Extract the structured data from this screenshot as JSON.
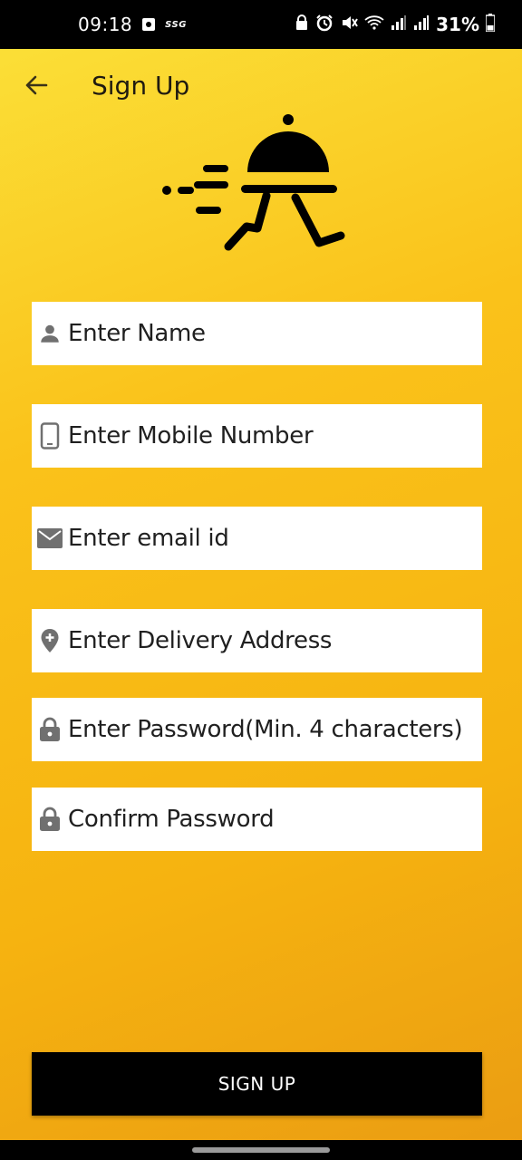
{
  "status_bar": {
    "time": "09:18",
    "carrier_badge": "SSG",
    "battery_percent": "31%",
    "icons": [
      "gallery-icon",
      "lock-icon",
      "alarm-icon",
      "mute-icon",
      "wifi-icon",
      "signal-icon",
      "signal-icon",
      "battery-icon"
    ]
  },
  "app_bar": {
    "title": "Sign Up",
    "back_icon": "arrow-left-icon"
  },
  "form": {
    "fields": [
      {
        "icon": "person-icon",
        "placeholder": "Enter Name"
      },
      {
        "icon": "phone-icon",
        "placeholder": "Enter Mobile Number"
      },
      {
        "icon": "mail-icon",
        "placeholder": "Enter email id"
      },
      {
        "icon": "location-pin-icon",
        "placeholder": "Enter Delivery Address"
      },
      {
        "icon": "lock-icon",
        "placeholder": "Enter Password(Min. 4 characters)"
      },
      {
        "icon": "lock-icon",
        "placeholder": "Confirm Password"
      }
    ],
    "submit_label": "SIGN UP"
  },
  "colors": {
    "background_top": "#fbe23a",
    "background_bottom": "#ea9c12",
    "field_bg": "#ffffff",
    "button_bg": "#000000",
    "icon_gray": "#707070"
  }
}
